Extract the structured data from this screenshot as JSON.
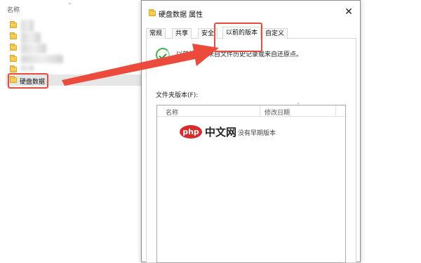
{
  "explorer": {
    "column_header": "名称",
    "selected_folder": "硬盘数据"
  },
  "dialog": {
    "title": "硬盘数据 属性",
    "close_symbol": "✕",
    "tabs": [
      {
        "label": "常规",
        "active": false
      },
      {
        "label": "共享",
        "active": false
      },
      {
        "label": "安全",
        "active": false
      },
      {
        "label": "以前的版本",
        "active": true
      },
      {
        "label": "自定义",
        "active": false
      }
    ],
    "description": "以前的版本来自文件历史记录或来自还原点。",
    "folder_versions_label": "文件夹版本(F):",
    "list_columns": {
      "name": "名称",
      "modified": "修改日期"
    },
    "list_empty_text": "没有早期版本"
  },
  "watermark": {
    "logo": "php",
    "text": "中文网"
  },
  "colors": {
    "highlight_red": "#ec4a3b",
    "watermark_red": "#d92b2b"
  },
  "icons": [
    "folder-icon",
    "close-icon",
    "restore-icon",
    "sort-caret-icon"
  ]
}
